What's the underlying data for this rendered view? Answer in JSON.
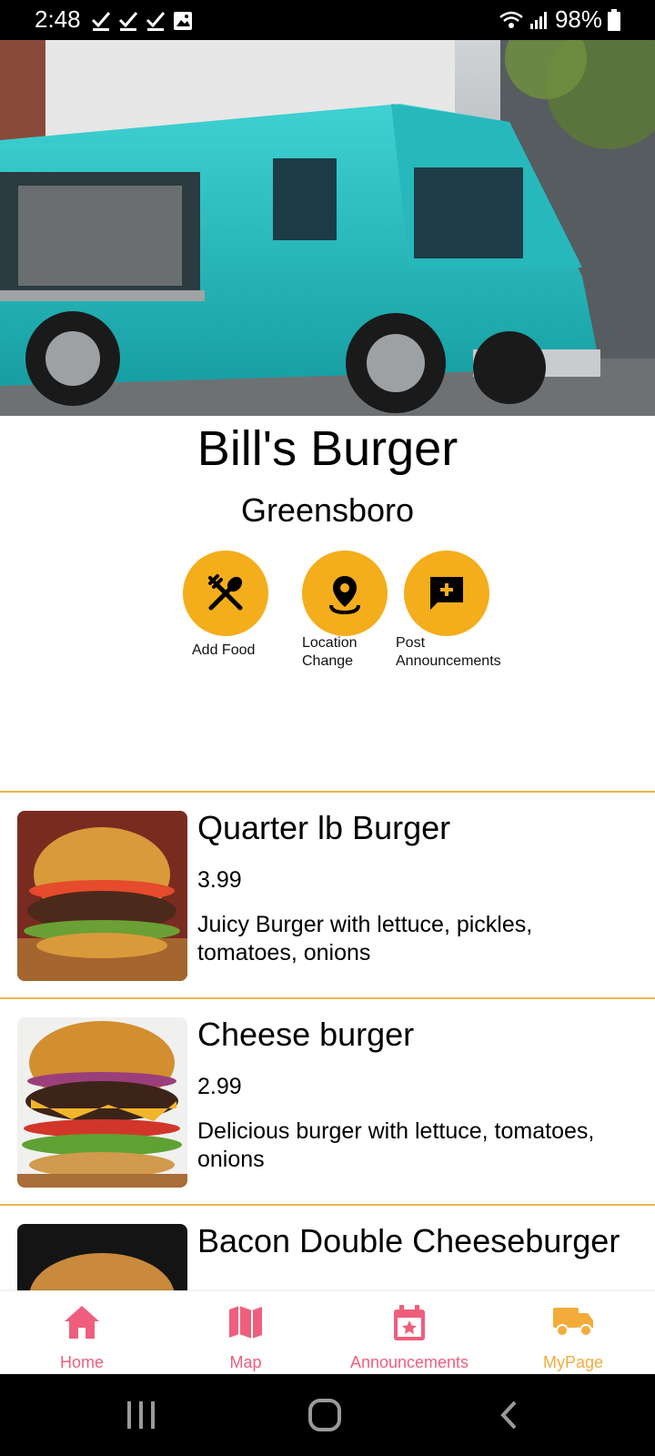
{
  "status_bar": {
    "time": "2:48",
    "battery": "98%"
  },
  "vendor": {
    "name": "Bill's Burger",
    "city": "Greensboro"
  },
  "actions": [
    {
      "label": "Add Food",
      "icon": "utensils-icon"
    },
    {
      "label": "Location\nChange",
      "icon": "location-pin-icon"
    },
    {
      "label": "Post\nAnnouncements",
      "icon": "add-comment-icon"
    }
  ],
  "menu": [
    {
      "name": "Quarter lb Burger",
      "price": "3.99",
      "description": "Juicy Burger with lettuce, pickles, tomatoes, onions"
    },
    {
      "name": "Cheese burger",
      "price": "2.99",
      "description": "Delicious burger with lettuce, tomatoes, onions"
    },
    {
      "name": "Bacon Double Cheeseburger",
      "price": "",
      "description": ""
    }
  ],
  "bottom_nav": [
    {
      "label": "Home",
      "icon": "home-icon"
    },
    {
      "label": "Map",
      "icon": "map-icon"
    },
    {
      "label": "Announcements",
      "icon": "calendar-star-icon"
    },
    {
      "label": "MyPage",
      "icon": "truck-icon"
    }
  ],
  "colors": {
    "accent": "#f4ad1b",
    "nav_inactive": "#ef5f7d",
    "nav_active": "#f3ac3a",
    "divider": "#e9b84a"
  }
}
